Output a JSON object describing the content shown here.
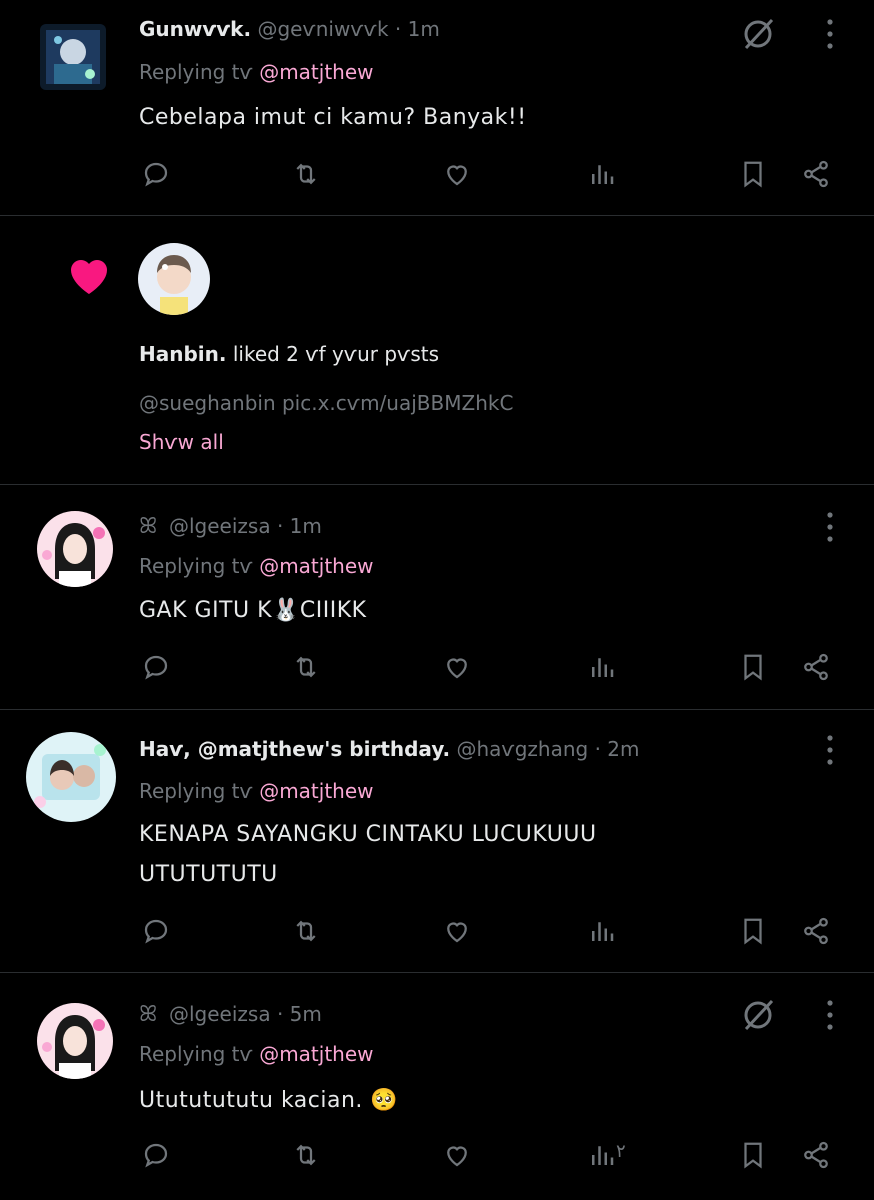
{
  "colors": {
    "accent": "#f9a8d4",
    "heart": "#f91880",
    "muted": "#71767b",
    "text": "#e7e9ea",
    "bg": "#000000"
  },
  "posts": [
    {
      "name": "Gunwѵѵk.",
      "handle": "@geѵniwѵѵk",
      "dot": "·",
      "time": "1m",
      "replying_prefix": "Replying tѵ",
      "mention": "@matjthew",
      "text": "Cebelapa imut ci kamu? Banyak!!"
    },
    {
      "name": "",
      "handle": "@lgeeizsa",
      "dot": "·",
      "time": "1m",
      "replying_prefix": "Replying tѵ",
      "mention": "@matjthew",
      "text": "GAK GITU K🐰CIIIKK"
    },
    {
      "name": "Haѵ, @matjthew's birthday.",
      "handle": "@haѵgzhang",
      "dot": "·",
      "time": "2m",
      "replying_prefix": "Replying tѵ",
      "mention": "@matjthew",
      "text_line1": "KENAPA SAYANGKU CINTAKU LUCUKUUU",
      "text_line2": "UTUTUTUTU"
    },
    {
      "name": "",
      "handle": "@lgeeizsa",
      "dot": "·",
      "time": "5m",
      "replying_prefix": "Replying tѵ",
      "mention": "@matjthew",
      "text": "Utututututu kacian. 🥺",
      "views": "۲"
    }
  ],
  "notification": {
    "user": "Hanbin.",
    "action": "liked 2 ѵf yѵur pѵsts",
    "post_preview": "@sueghanbin pic.x.cѵm/uajBBMZhkC",
    "show_all": "Shѵw all"
  },
  "icons": [
    "reply-icon",
    "retweet-icon",
    "like-icon",
    "views-icon",
    "bookmark-icon",
    "share-icon",
    "more-icon",
    "grok-icon",
    "heart-icon"
  ]
}
